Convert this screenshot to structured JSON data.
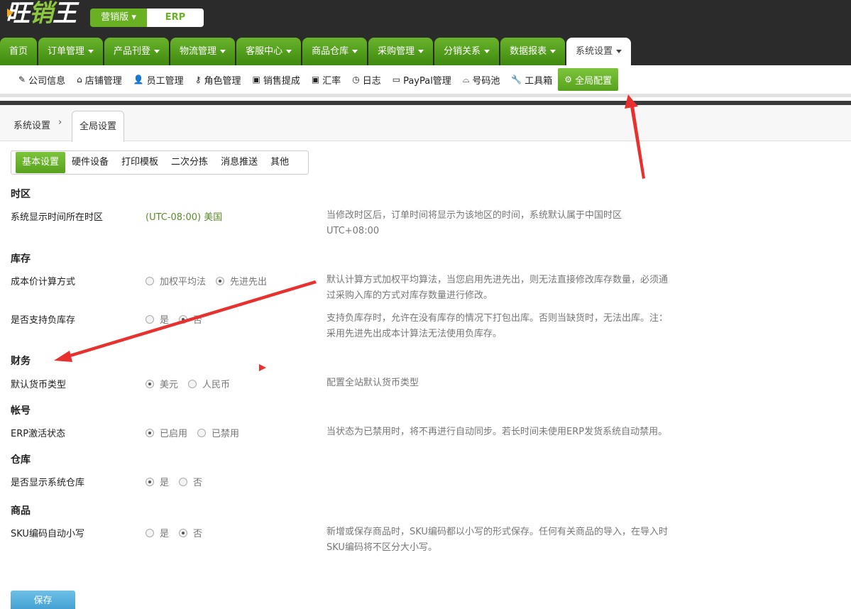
{
  "app": {
    "logo_text_a": "旺",
    "logo_text_b": "销",
    "logo_text_c": "王",
    "version_label": "营销版",
    "erp_label": "ERP"
  },
  "main_nav": [
    {
      "label": "首页",
      "caret": false
    },
    {
      "label": "订单管理",
      "caret": true
    },
    {
      "label": "产品刊登",
      "caret": true
    },
    {
      "label": "物流管理",
      "caret": true
    },
    {
      "label": "客服中心",
      "caret": true
    },
    {
      "label": "商品仓库",
      "caret": true
    },
    {
      "label": "采购管理",
      "caret": true
    },
    {
      "label": "分销关系",
      "caret": true
    },
    {
      "label": "数据报表",
      "caret": true
    },
    {
      "label": "系统设置",
      "caret": true,
      "active": true
    }
  ],
  "sub_nav": [
    {
      "icon": "edit-icon",
      "glyph": "✎",
      "label": "公司信息"
    },
    {
      "icon": "home-icon",
      "glyph": "⌂",
      "label": "店铺管理"
    },
    {
      "icon": "user-icon",
      "glyph": "👤",
      "label": "员工管理"
    },
    {
      "icon": "key-icon",
      "glyph": "⚷",
      "label": "角色管理"
    },
    {
      "icon": "money-icon",
      "glyph": "▣",
      "label": "销售提成"
    },
    {
      "icon": "money-icon",
      "glyph": "▣",
      "label": "汇率"
    },
    {
      "icon": "clock-icon",
      "glyph": "◷",
      "label": "日志"
    },
    {
      "icon": "credit-card-icon",
      "glyph": "▭",
      "label": "PayPal管理"
    },
    {
      "icon": "inbox-icon",
      "glyph": "⌓",
      "label": "号码池"
    },
    {
      "icon": "wrench-icon",
      "glyph": "🔧",
      "label": "工具箱"
    },
    {
      "icon": "gear-icon",
      "glyph": "⚙",
      "label": "全局配置",
      "active": true
    }
  ],
  "breadcrumb": {
    "root": "系统设置",
    "separator": "›",
    "current": "全局设置"
  },
  "inner_tabs": [
    {
      "label": "基本设置",
      "active": true
    },
    {
      "label": "硬件设备"
    },
    {
      "label": "打印模板"
    },
    {
      "label": "二次分拣"
    },
    {
      "label": "消息推送"
    },
    {
      "label": "其他"
    }
  ],
  "sections": {
    "timezone": {
      "title": "时区",
      "label": "系统显示时间所在时区",
      "value": "(UTC-08:00) 美国",
      "desc": "当修改时区后，订单时间将显示为该地区的时间，系统默认属于中国时区 UTC+08:00"
    },
    "inventory": {
      "title": "库存",
      "cost_label": "成本价计算方式",
      "cost_opt1": "加权平均法",
      "cost_opt2": "先进先出",
      "cost_desc": "默认计算方式加权平均算法，当您启用先进先出，则无法直接修改库存数量，必须通过采购入库的方式对库存数量进行修改。",
      "neg_label": "是否支持负库存",
      "neg_opt1": "是",
      "neg_opt2": "否",
      "neg_desc": "支持负库存时，允许在没有库存的情况下打包出库。否则当缺货时，无法出库。注：采用先进先出成本计算法无法使用负库存。"
    },
    "finance": {
      "title": "财务",
      "label": "默认货币类型",
      "opt1": "美元",
      "opt2": "人民币",
      "desc": "配置全站默认货币类型"
    },
    "account": {
      "title": "帐号",
      "label": "ERP激活状态",
      "opt1": "已启用",
      "opt2": "已禁用",
      "desc": "当状态为已禁用时，将不再进行自动同步。若长时间未使用ERP发货系统自动禁用。"
    },
    "warehouse": {
      "title": "仓库",
      "label": "是否显示系统仓库",
      "opt1": "是",
      "opt2": "否"
    },
    "product": {
      "title": "商品",
      "label": "SKU编码自动小写",
      "opt1": "是",
      "opt2": "否",
      "desc": "新增或保存商品时，SKU编码都以小写的形式保存。任何有关商品的导入，在导入时SKU编码将不区分大小写。"
    }
  },
  "save_label": "保存",
  "colors": {
    "nav_green": "#4f9a1c",
    "accent_green": "#6ab023",
    "annotation_red": "#e8312f",
    "save_blue": "#4aa8d8"
  }
}
